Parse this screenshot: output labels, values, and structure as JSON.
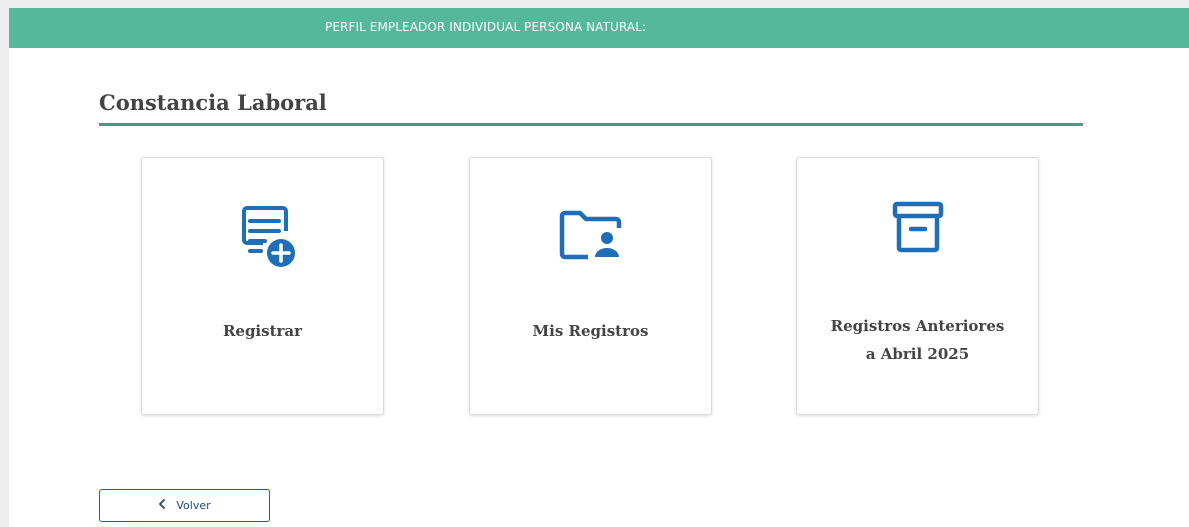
{
  "header": {
    "profile_text": "PERFIL EMPLEADOR INDIVIDUAL PERSONA NATURAL:"
  },
  "main": {
    "title": "Constancia Laboral",
    "cards": [
      {
        "icon": "document-add-icon",
        "label": "Registrar"
      },
      {
        "icon": "folder-user-icon",
        "label": "Mis Registros"
      },
      {
        "icon": "archive-box-icon",
        "label_line1": "Registros Anteriores",
        "label_line2": "a Abril 2025"
      }
    ]
  },
  "footer": {
    "back_label": "Volver",
    "back_icon": "chevron-left-icon"
  },
  "colors": {
    "header_bg": "#55b89a",
    "accent_rule": "#4a9a7f",
    "icon_blue": "#1f6fb8"
  }
}
